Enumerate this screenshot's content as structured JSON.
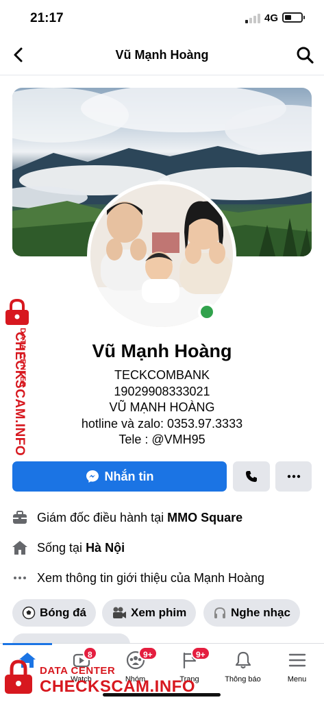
{
  "status_bar": {
    "time": "21:17",
    "network": "4G"
  },
  "header": {
    "title": "Vũ Mạnh Hoàng"
  },
  "profile": {
    "name": "Vũ Mạnh Hoàng",
    "bio_lines": [
      "TECKCOMBANK",
      "19029908333021",
      "VŨ MẠNH HOÀNG",
      "hotline và zalo: 0353.97.3333",
      "Tele : @VMH95"
    ],
    "online": true
  },
  "actions": {
    "message_label": "Nhắn tin"
  },
  "details": {
    "work_prefix": "Giám đốc điều hành tại ",
    "work_place": "MMO Square",
    "home_prefix": "Sống tại ",
    "home_place": "Hà Nội",
    "about_link": "Xem thông tin giới thiệu của Mạnh Hoàng"
  },
  "hobbies": [
    {
      "label": "Bóng đá",
      "icon": "soccer-ball-icon"
    },
    {
      "label": "Xem phim",
      "icon": "film-camera-icon"
    },
    {
      "label": "Nghe nhạc",
      "icon": "headphones-icon"
    }
  ],
  "tabs": [
    {
      "label": "tin",
      "icon": "home-icon",
      "active": true
    },
    {
      "label": "Watch",
      "icon": "watch-icon",
      "badge": "8"
    },
    {
      "label": "Nhóm",
      "icon": "groups-icon",
      "badge": "9+"
    },
    {
      "label": "Trang",
      "icon": "flag-icon",
      "badge": "9+"
    },
    {
      "label": "Thông báo",
      "icon": "bell-icon"
    },
    {
      "label": "Menu",
      "icon": "menu-icon"
    }
  ],
  "watermark": {
    "line1": "DATA CENTER",
    "line2": "CHECKSCAM.INFO"
  },
  "colors": {
    "accent": "#1b74e4",
    "online": "#31a24c",
    "badge": "#e41e3f",
    "watermark": "#d7181f"
  }
}
